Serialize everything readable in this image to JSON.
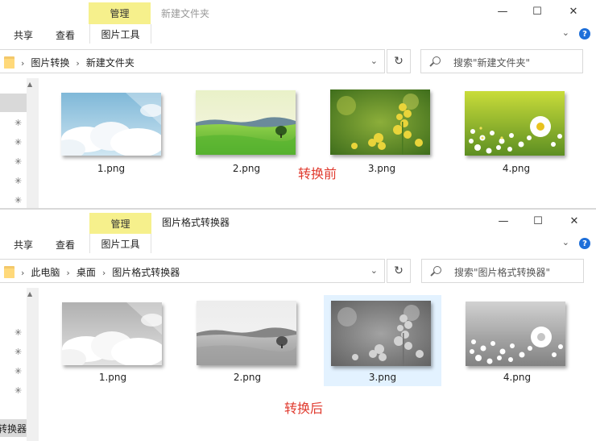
{
  "top_window": {
    "manage_tab": "管理",
    "title": "新建文件夹",
    "ribbon": {
      "share": "共享",
      "view": "查看",
      "picture_tools": "图片工具"
    },
    "breadcrumbs": [
      "图片转换",
      "新建文件夹"
    ],
    "search_placeholder": "搜索\"新建文件夹\"",
    "files": [
      {
        "name": "1.png",
        "scene": "sky-clouds"
      },
      {
        "name": "2.png",
        "scene": "green-meadow"
      },
      {
        "name": "3.png",
        "scene": "rapeseed-flowers"
      },
      {
        "name": "4.png",
        "scene": "daisy-field"
      }
    ],
    "caption": "转换前"
  },
  "bottom_window": {
    "manage_tab": "管理",
    "title": "图片格式转换器",
    "ribbon": {
      "share": "共享",
      "view": "查看",
      "picture_tools": "图片工具"
    },
    "breadcrumbs": [
      "此电脑",
      "桌面",
      "图片格式转换器"
    ],
    "search_placeholder": "搜索\"图片格式转换器\"",
    "nav_selected_label": "转换器",
    "files": [
      {
        "name": "1.png",
        "scene": "sky-clouds"
      },
      {
        "name": "2.png",
        "scene": "green-meadow"
      },
      {
        "name": "3.png",
        "scene": "rapeseed-flowers",
        "selected": true
      },
      {
        "name": "4.png",
        "scene": "daisy-field"
      }
    ],
    "caption": "转换后"
  },
  "icons": {
    "minimize": "minimize-icon",
    "maximize": "maximize-icon",
    "close": "close-icon",
    "refresh": "refresh-icon",
    "search": "search-icon",
    "pin": "pin-icon",
    "folder": "folder-icon"
  },
  "colors": {
    "manage_tab": "#f6f08c",
    "caption": "#e03a2e",
    "help": "#1e6fd9",
    "selection": "#cce8ff"
  }
}
